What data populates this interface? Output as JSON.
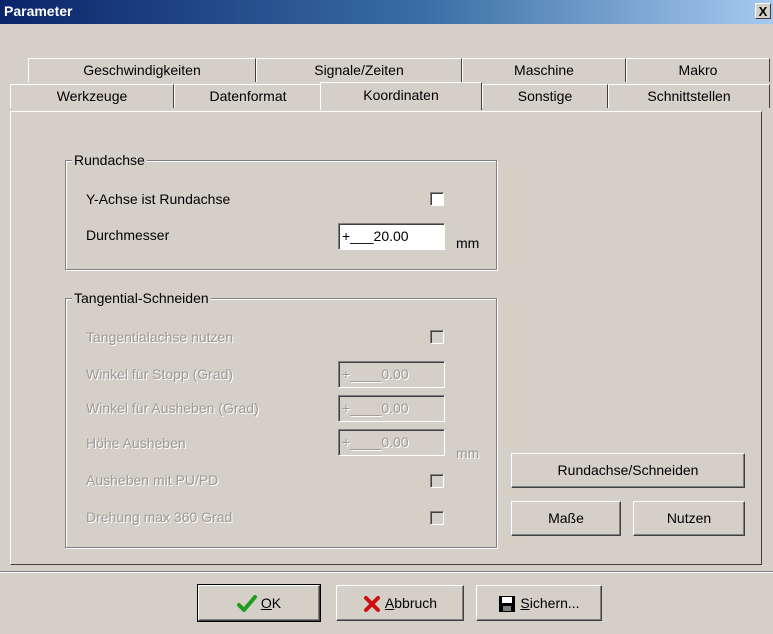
{
  "window": {
    "title": "Parameter",
    "close_glyph": "X"
  },
  "tabs_row1": [
    {
      "label": "Geschwindigkeiten"
    },
    {
      "label": "Signale/Zeiten"
    },
    {
      "label": "Maschine"
    },
    {
      "label": "Makro"
    }
  ],
  "tabs_row2": [
    {
      "label": "Werkzeuge"
    },
    {
      "label": "Datenformat"
    },
    {
      "label": "Koordinaten"
    },
    {
      "label": "Sonstige"
    },
    {
      "label": "Schnittstellen"
    }
  ],
  "active_tab": "Koordinaten",
  "rundachse": {
    "title": "Rundachse",
    "y_axis_label": "Y-Achse ist Rundachse",
    "y_axis_checked": false,
    "diameter_label": "Durchmesser",
    "diameter_value": "+___20.00",
    "diameter_unit": "mm"
  },
  "tangential": {
    "title": "Tangential-Schneiden",
    "use_axis_label": "Tangentialachse nutzen",
    "use_axis_checked": false,
    "stop_angle_label": "Winkel für Stopp (Grad)",
    "stop_angle_value": "+____0.00",
    "lift_angle_label": "Winkel für Ausheben (Grad)",
    "lift_angle_value": "+____0.00",
    "lift_height_label": "Höhe Ausheben",
    "lift_height_value": "+____0.00",
    "lift_height_unit": "mm",
    "lift_pu_pd_label": "Ausheben mit PU/PD",
    "lift_pu_pd_checked": false,
    "rotation_label": "Drehung max 360 Grad",
    "rotation_checked": false
  },
  "side_buttons": {
    "rundachse_schneiden": "Rundachse/Schneiden",
    "masse": "Maße",
    "nutzen": "Nutzen"
  },
  "footer": {
    "ok_key": "O",
    "ok_rest": "K",
    "cancel_key": "A",
    "cancel_rest": "bbruch",
    "save_key": "S",
    "save_rest": "ichern..."
  },
  "icons": {
    "ok": "checkmark-icon",
    "cancel": "x-icon",
    "save": "floppy-disk-icon"
  },
  "colors": {
    "title_gradient_start": "#0a246a",
    "title_gradient_end": "#a6caf0",
    "face": "#d4d0c8",
    "disabled_text": "#9c9a94",
    "ok_green": "#1e9c1e",
    "cancel_red": "#d01010"
  }
}
